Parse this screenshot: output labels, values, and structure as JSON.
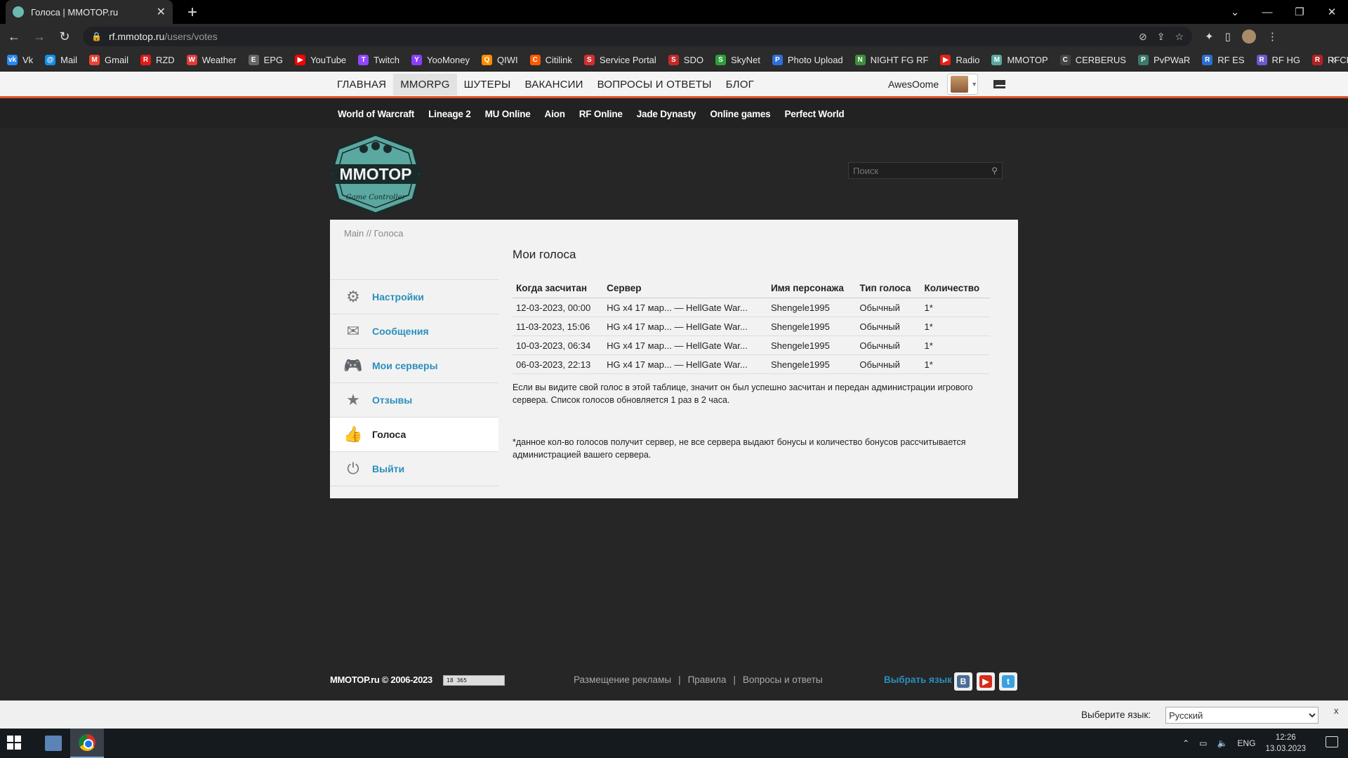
{
  "browser": {
    "tab_title": "Голоса | MMOTOP.ru",
    "url_host": "rf.mmotop.ru",
    "url_path": "/users/votes",
    "bookmarks": [
      {
        "label": "Vk",
        "color": "#2787f5",
        "glyph": "vk"
      },
      {
        "label": "Mail",
        "color": "#168de2",
        "glyph": "@"
      },
      {
        "label": "Gmail",
        "color": "#ea4335",
        "glyph": "M"
      },
      {
        "label": "RZD",
        "color": "#e21a1a",
        "glyph": "R"
      },
      {
        "label": "Weather",
        "color": "#e03a3a",
        "glyph": "W"
      },
      {
        "label": "EPG",
        "color": "#666666",
        "glyph": "E"
      },
      {
        "label": "YouTube",
        "color": "#ff0000",
        "glyph": "▶"
      },
      {
        "label": "Twitch",
        "color": "#9146ff",
        "glyph": "T"
      },
      {
        "label": "YooMoney",
        "color": "#8b3ffd",
        "glyph": "Y"
      },
      {
        "label": "QIWI",
        "color": "#ff8c00",
        "glyph": "Q"
      },
      {
        "label": "Citilink",
        "color": "#ff5a00",
        "glyph": "C"
      },
      {
        "label": "Service Portal",
        "color": "#d32f2f",
        "glyph": "S"
      },
      {
        "label": "SDO",
        "color": "#c62828",
        "glyph": "S"
      },
      {
        "label": "SkyNet",
        "color": "#2e9e3a",
        "glyph": "S"
      },
      {
        "label": "Photo Upload",
        "color": "#2e6fd8",
        "glyph": "P"
      },
      {
        "label": "NIGHT FG RF",
        "color": "#3a8f3a",
        "glyph": "N"
      },
      {
        "label": "Radio",
        "color": "#e62117",
        "glyph": "▶"
      },
      {
        "label": "MMOTOP",
        "color": "#5aa8a0",
        "glyph": "M"
      },
      {
        "label": "CERBERUS",
        "color": "#444444",
        "glyph": "C"
      },
      {
        "label": "PvPWaR",
        "color": "#3a7a6a",
        "glyph": "P"
      },
      {
        "label": "RF ES",
        "color": "#2a6fd0",
        "glyph": "R"
      },
      {
        "label": "RF HG",
        "color": "#6a5acd",
        "glyph": "R"
      },
      {
        "label": "RFCH",
        "color": "#b22222",
        "glyph": "R"
      }
    ]
  },
  "site": {
    "main_menu": [
      "ГЛАВНАЯ",
      "MMORPG",
      "ШУТЕРЫ",
      "ВАКАНСИИ",
      "ВОПРОСЫ И ОТВЕТЫ",
      "БЛОГ"
    ],
    "active_menu": "MMORPG",
    "username": "AwesOome",
    "game_links": [
      "World of Warcraft",
      "Lineage 2",
      "MU Online",
      "Aion",
      "RF Online",
      "Jade Dynasty",
      "Online games",
      "Perfect World"
    ],
    "logo_text": "MMOTOP",
    "logo_subtext": "Game Controller",
    "search_placeholder": "Поиск",
    "accent_color": "#e0502a",
    "link_color": "#2a8fbd"
  },
  "breadcrumb": "Main // Голоса",
  "sidenav": [
    {
      "label": "Настройки",
      "icon": "gear-icon",
      "current": false
    },
    {
      "label": "Сообщения",
      "icon": "envelope-icon",
      "current": false
    },
    {
      "label": "Мои серверы",
      "icon": "gamepad-icon",
      "current": false
    },
    {
      "label": "Отзывы",
      "icon": "star-icon",
      "current": false
    },
    {
      "label": "Голоса",
      "icon": "thumbs-up-icon",
      "current": true
    },
    {
      "label": "Выйти",
      "icon": "power-icon",
      "current": false
    }
  ],
  "votes": {
    "title": "Мои голоса",
    "columns": [
      "Когда засчитан",
      "Сервер",
      "Имя персонажа",
      "Тип голоса",
      "Количество"
    ],
    "rows": [
      [
        "12-03-2023, 00:00",
        "HG x4 17 мар... — HellGate War...",
        "Shengele1995",
        "Обычный",
        "1*"
      ],
      [
        "11-03-2023, 15:06",
        "HG x4 17 мар... — HellGate War...",
        "Shengele1995",
        "Обычный",
        "1*"
      ],
      [
        "10-03-2023, 06:34",
        "HG x4 17 мар... — HellGate War...",
        "Shengele1995",
        "Обычный",
        "1*"
      ],
      [
        "06-03-2023, 22:13",
        "HG x4 17 мар... — HellGate War...",
        "Shengele1995",
        "Обычный",
        "1*"
      ]
    ],
    "note": "Если вы видите свой голос в этой таблице, значит он был успешно засчитан и передан администрации игрового сервера. Список голосов обновляется 1 раз в 2 часа.",
    "footnote": "*данное кол-во голосов получит сервер, не все сервера выдают бонусы и количество бонусов рассчитывается администрацией вашего сервера."
  },
  "footer": {
    "copyright": "MMOTOP.ru © 2006-2023",
    "counter": "18 365",
    "links": [
      "Размещение рекламы",
      "Правила",
      "Вопросы и ответы"
    ],
    "separator": "|",
    "language_link": "Выбрать язык"
  },
  "translate_bar": {
    "label": "Выберите язык:",
    "selected": "Русский",
    "close": "x"
  },
  "taskbar": {
    "lang": "ENG",
    "time": "12:26",
    "date": "13.03.2023"
  }
}
